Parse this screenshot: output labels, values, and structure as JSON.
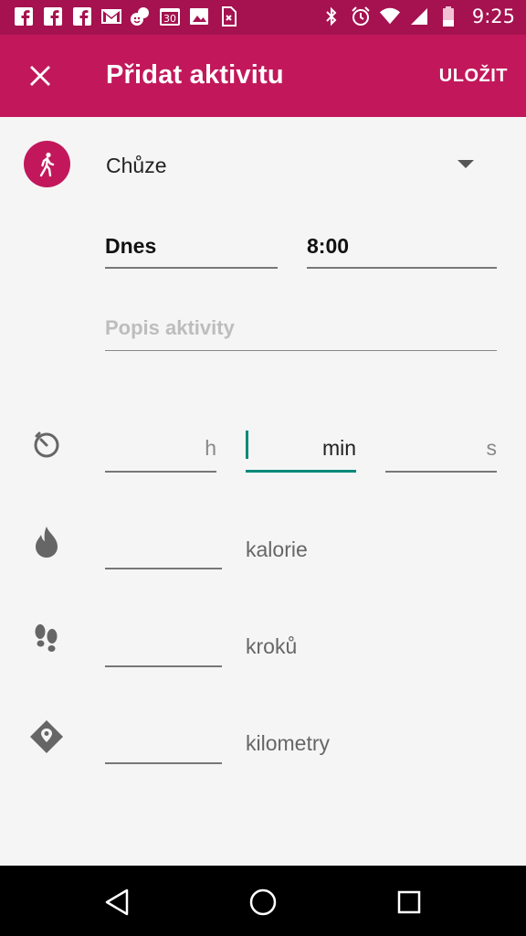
{
  "status_bar": {
    "time": "9:25",
    "calendar_day": "30",
    "notification_icons": [
      "facebook-icon",
      "facebook-icon",
      "facebook-icon",
      "gmail-icon",
      "hangouts-icon",
      "calendar-icon",
      "image-icon",
      "sim-icon"
    ],
    "system_icons": [
      "bluetooth-icon",
      "alarm-icon",
      "wifi-icon",
      "signal-icon",
      "battery-icon"
    ]
  },
  "app_bar": {
    "title": "Přidat aktivitu",
    "save_label": "ULOŽIT",
    "close_icon": "close-icon",
    "background": "#c2185b"
  },
  "activity": {
    "name": "Chůze",
    "icon": "walk-icon"
  },
  "date": {
    "value": "Dnes"
  },
  "time": {
    "value": "8:00"
  },
  "description": {
    "placeholder": "Popis aktivity",
    "value": ""
  },
  "duration": {
    "icon": "timer-icon",
    "hours_unit": "h",
    "minutes_unit": "min",
    "seconds_unit": "s",
    "focused": "minutes",
    "accent": "#00897b"
  },
  "calories": {
    "icon": "flame-icon",
    "label": "kalorie",
    "value": ""
  },
  "steps": {
    "icon": "footsteps-icon",
    "label": "kroků",
    "value": ""
  },
  "distance": {
    "icon": "location-icon",
    "label": "kilometry",
    "value": ""
  },
  "nav_bar": {
    "buttons": [
      "back-icon",
      "home-icon",
      "recents-icon"
    ]
  }
}
